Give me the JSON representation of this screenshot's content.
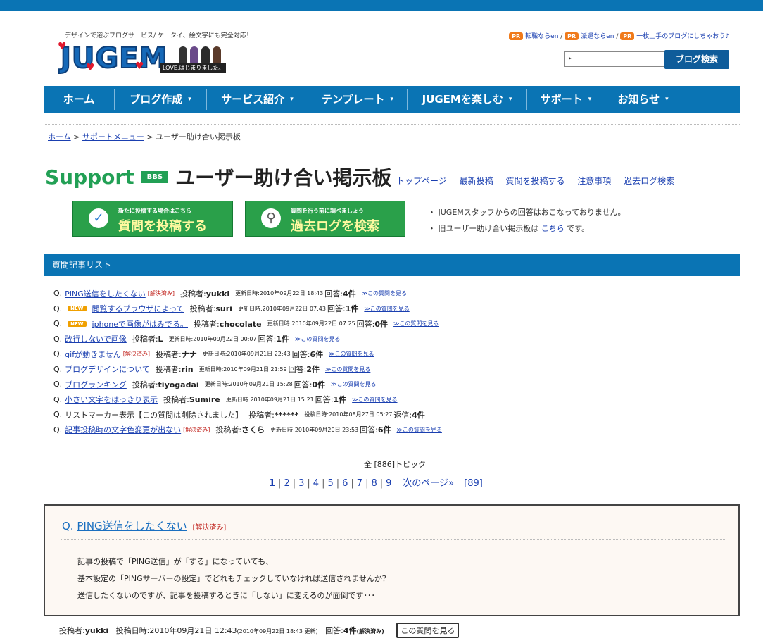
{
  "header": {
    "tagline": "デザインで選ぶブログサービス/ ケータイ、絵文字にも完全対応！",
    "logo_text": "JUGEM",
    "logo_badge": "LOVE,はじまりました。",
    "pr_label": "PR",
    "pr_links": [
      "転職ならen",
      "派遣ならen",
      "一枚上手のブログにしちゃおう♪"
    ],
    "search_button": "ブログ検索",
    "search_caret": "▸"
  },
  "nav": {
    "items": [
      {
        "label": "ホーム",
        "arrow": ""
      },
      {
        "label": "ブログ作成",
        "arrow": "▾"
      },
      {
        "label": "サービス紹介",
        "arrow": "▾"
      },
      {
        "label": "テンプレート",
        "arrow": "▾"
      },
      {
        "label": "JUGEMを楽しむ",
        "arrow": "▾"
      },
      {
        "label": "サポート",
        "arrow": "▾"
      },
      {
        "label": "お知らせ",
        "arrow": "▾"
      }
    ]
  },
  "breadcrumb": {
    "home": "ホーム",
    "support": "サポートメニュー",
    "current": "ユーザー助け合い掲示板",
    "sep": ">"
  },
  "page": {
    "support_word": "Support",
    "bbs_badge": "BBS",
    "title": "ユーザー助け合い掲示板",
    "links": [
      "トップページ",
      "最新投稿",
      "質問を投稿する",
      "注意事項",
      "過去ログ検索"
    ],
    "btn_post_small": "新たに投稿する場合はこちら",
    "btn_post_main": "質問を投稿する",
    "btn_post_icon": "✓",
    "btn_search_small": "質問を行う前に調べましょう",
    "btn_search_main": "過去ログを検索",
    "btn_search_icon": "⚲",
    "note1": "・ JUGEMスタッフからの回答はおこなっておりません。",
    "note2_pre": "・ 旧ユーザー助け合い掲示板は ",
    "note2_link": "こちら",
    "note2_post": " です。"
  },
  "list": {
    "header": "質問記事リスト",
    "prefix": "Q.",
    "by_label": "投稿者:",
    "upd_label": "更新日時:",
    "ans_label": "回答:",
    "view_label": "≫この質問を見る",
    "resolved_label": "[解決済み]",
    "new_label": "NEW",
    "rows": [
      {
        "title": "PING送信をしたくない",
        "resolved": true,
        "new": false,
        "author": "yukki",
        "updated": "2010年09月22日 18:43",
        "answers": "4件",
        "is_link": true,
        "ans_label": "回答:"
      },
      {
        "title": "閲覧するブラウザによって",
        "resolved": false,
        "new": true,
        "author": "suri",
        "updated": "2010年09月22日 07:43",
        "answers": "1件",
        "is_link": true,
        "ans_label": "回答:"
      },
      {
        "title": "iphoneで画像がはみでる。",
        "resolved": false,
        "new": true,
        "author": "chocolate",
        "updated": "2010年09月22日 07:25",
        "answers": "0件",
        "is_link": true,
        "ans_label": "回答:"
      },
      {
        "title": "改行しないで画像",
        "resolved": false,
        "new": false,
        "author": "L",
        "updated": "2010年09月22日 00:07",
        "answers": "1件",
        "is_link": true,
        "ans_label": "回答:"
      },
      {
        "title": "gifが動きません",
        "resolved": true,
        "new": false,
        "author": "ナナ",
        "updated": "2010年09月21日 22:43",
        "answers": "6件",
        "is_link": true,
        "ans_label": "回答:"
      },
      {
        "title": "ブログデザインについて",
        "resolved": false,
        "new": false,
        "author": "rin",
        "updated": "2010年09月21日 21:59",
        "answers": "2件",
        "is_link": true,
        "ans_label": "回答:"
      },
      {
        "title": "ブログランキング",
        "resolved": false,
        "new": false,
        "author": "tiyogadai",
        "updated": "2010年09月21日 15:28",
        "answers": "0件",
        "is_link": true,
        "ans_label": "回答:"
      },
      {
        "title": "小さい文字をはっきり表示",
        "resolved": false,
        "new": false,
        "author": "Sumire",
        "updated": "2010年09月21日 15:21",
        "answers": "1件",
        "is_link": true,
        "ans_label": "回答:"
      },
      {
        "title": "リストマーカー表示【この質問は削除されました】",
        "resolved": false,
        "new": false,
        "author": "******",
        "updated": "2010年08月27日 05:27",
        "answers": "4件",
        "is_link": false,
        "ans_label": "返信:",
        "upd_label": "投稿日時:"
      },
      {
        "title": "記事投稿時の文字色変更が出ない",
        "resolved": true,
        "new": false,
        "author": "さくら",
        "updated": "2010年09月20日 23:53",
        "answers": "6件",
        "is_link": true,
        "ans_label": "回答:"
      }
    ]
  },
  "pagination": {
    "total": "全 [886]トピック",
    "pages": [
      "1",
      "2",
      "3",
      "4",
      "5",
      "6",
      "7",
      "8",
      "9"
    ],
    "next": "次のページ»",
    "last": "[89]"
  },
  "detail": {
    "prefix": "Q.",
    "title": "PING送信をしたくない",
    "resolved": "[解決済み]",
    "body": [
      "記事の投稿で「PING送信」が「する」になっていても、",
      "基本設定の「PINGサーバーの設定」でどれもチェックしていなければ送信されませんか？",
      "送信したくないのですが、記事を投稿するときに「しない」に変えるのが面倒です･･･"
    ]
  },
  "footer": {
    "by_label": "投稿者:",
    "author": "yukki",
    "posted_label": "投稿日時:",
    "posted": "2010年09月21日 12:43",
    "updated_note": "(2010年09月22日 18:43 更新)",
    "ans_label": "回答:",
    "answers": "4件",
    "resolved_note": "(解決済み)",
    "view_button": "この質問を見る"
  },
  "colors": {
    "brand_blue": "#0a74b4",
    "support_green": "#22a055",
    "pr_orange": "#f07a1a",
    "resolved_red": "#c0201a"
  }
}
